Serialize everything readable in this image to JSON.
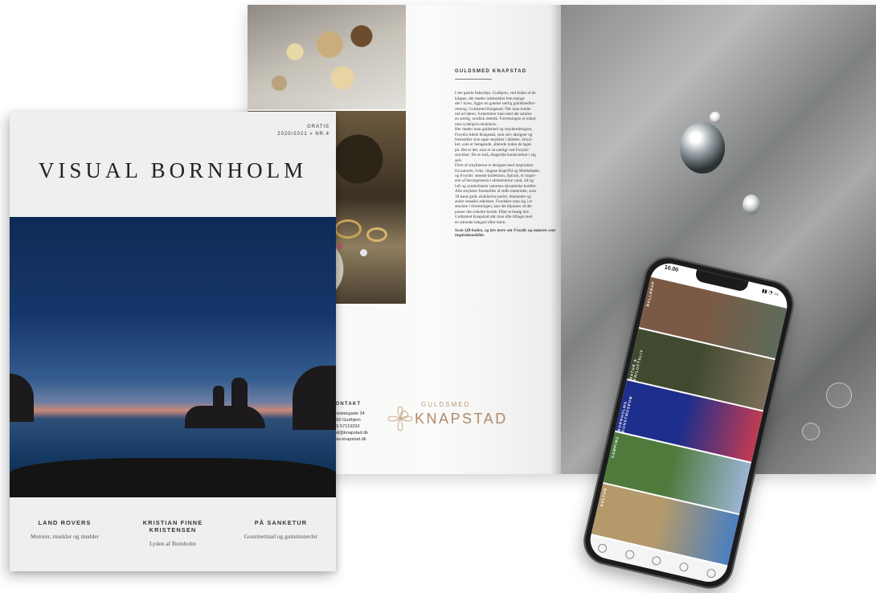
{
  "cover": {
    "tag_line1": "GRATIS",
    "tag_line2": "2020/2021 » NR.4",
    "title": "VISUAL BORNHOLM",
    "features": [
      {
        "title": "LAND ROVERS",
        "subtitle": "Motorer, muskler og mudder"
      },
      {
        "title": "KRISTIAN FINNE KRISTENSEN",
        "subtitle": "Lyden af Bornholm"
      },
      {
        "title": "PÅ SANKETUR",
        "subtitle": "Gourmetmad og gummistøvler"
      }
    ]
  },
  "article": {
    "title": "GULDSMED KNAPSTAD",
    "lines": [
      "I det gamle fiskerleje, Gudhjem, ved foden af de",
      "klipper, der møder udsmykket fem mange",
      "der i byen, ligger en ganske særlig guldsmedfor-",
      "retning: Guldsmed Knapstad. Når man træder",
      "ind ad døren, fornemmer man med det samme",
      "en særlig, nordisk æstetik. Forretningen er enkel,",
      "men tydeligvis eksklusiv.",
      "Her møder man guldsmed og smykkedesigner,",
      "Froydis Adele Knapstad, som selv designer og",
      "fremstiller sine egne smykker i hånden. Smyk-",
      "ket, som er betagende, allerede inden de tages",
      "på. Det er dét, som er så særligt ved Froydis'",
      "smykker: De er små, drageride kunstværker i sig",
      "selv.",
      "Flere af smykkerne er designet med inspiration",
      "fra naturen, f.eks. ringene Kapriföl og Mælkebøtte,",
      "og Froydis' seneste kollektion, Spiralo, er inspir-",
      "eret af bevægelserne i elementerne vand, ild og",
      "luft og symboliserer naturens dynamiske kræfter.",
      "Alle smykker fremstilles af ædle materialer, som",
      "18 karat guld, eksklusive perler, diamanter og",
      "andre smukke ædelsten. Forelsker man sig i et",
      "smykke i forretningen, kan det tilpasses så det",
      "passer den enkelte kunde. Efter et besøg hos",
      "Guldsmed Knapstad står man ofte tilbage med",
      "en sitrende længsel efter mere."
    ],
    "caption": "Scan QR-koden, og læs mere om Froydis og naturen som inspirationskilde."
  },
  "contact": {
    "title": "KONTAKT",
    "lines": [
      "Ejnedalsgade 34",
      "3760 Gudhjem",
      "+45 57119293",
      "mail@knapstad.dk",
      "www.knapstad.dk"
    ]
  },
  "logo": {
    "top": "GULDSMED",
    "main": "KNAPSTAD",
    "color": "#b08a68"
  },
  "phone": {
    "time": "10.00",
    "status_icons": "▮▮ ◔ ▭",
    "rows": [
      {
        "label": "BALLERUP",
        "colors": [
          "#7a5a45",
          "#5d6b5a"
        ]
      },
      {
        "label": "NATUR & FRILUFTSLIV",
        "colors": [
          "#3f4a2f",
          "#7c6f5a"
        ]
      },
      {
        "label": "BORNHOLMS KUNSTMUSEUM",
        "colors": [
          "#1d2e8c",
          "#c23b52"
        ]
      },
      {
        "label": "CAMPING",
        "colors": [
          "#4f7a3c",
          "#9cb3d4"
        ]
      },
      {
        "label": "KULTUR",
        "colors": [
          "#b49a6b",
          "#4a7fbf"
        ]
      }
    ]
  },
  "colors": {
    "cover_sky": "#16366a",
    "page_bg": "#f7f7f6",
    "accent": "#b08a68"
  }
}
